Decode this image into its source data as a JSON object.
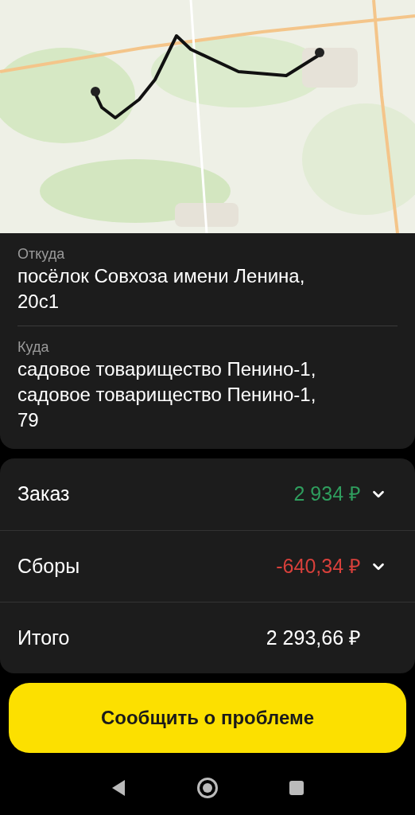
{
  "from": {
    "label": "Откуда",
    "lines": [
      "посёлок Совхоза имени Ленина,",
      "20с1"
    ]
  },
  "to": {
    "label": "Куда",
    "lines": [
      "садовое товарищество Пенино-1,",
      "садовое товарищество Пенино-1,",
      "79"
    ]
  },
  "rows": [
    {
      "label": "Заказ",
      "amount": "2 934 ₽",
      "kind": "income",
      "expandable": true
    },
    {
      "label": "Сборы",
      "amount": "-640,34 ₽",
      "kind": "expense",
      "expandable": true
    },
    {
      "label": "Итого",
      "amount": "2 293,66 ₽",
      "kind": "total",
      "expandable": false
    }
  ],
  "button": "Сообщить о проблеме"
}
